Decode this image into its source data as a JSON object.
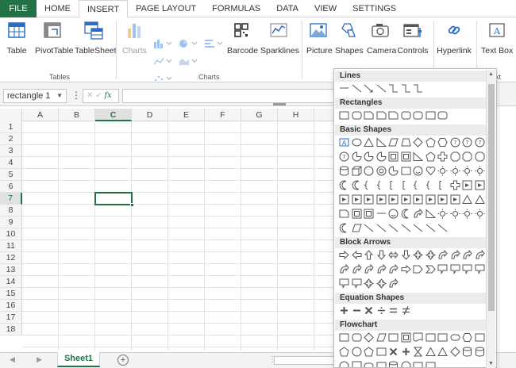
{
  "tabs": [
    {
      "label": "FILE"
    },
    {
      "label": "HOME"
    },
    {
      "label": "INSERT"
    },
    {
      "label": "PAGE LAYOUT"
    },
    {
      "label": "FORMULAS"
    },
    {
      "label": "DATA"
    },
    {
      "label": "VIEW"
    },
    {
      "label": "SETTINGS"
    }
  ],
  "ribbon": {
    "table": "Table",
    "pivottable": "PivotTable",
    "tablesheet": "TableSheet",
    "group_tables": "Tables",
    "charts": "Charts",
    "barcode": "Barcode",
    "sparklines": "Sparklines",
    "group_charts": "Charts",
    "picture": "Picture",
    "shapes": "Shapes",
    "camera": "Camera",
    "controls": "Controls",
    "hyperlink": "Hyperlink",
    "textbox": "Text Box",
    "group_text_partial": "xt"
  },
  "formula_bar": {
    "name_box": "rectangle 1",
    "fx": "fx",
    "formula": ""
  },
  "columns": [
    "A",
    "B",
    "C",
    "D",
    "E",
    "F",
    "G",
    "H"
  ],
  "selected_column": "C",
  "rows": [
    "1",
    "2",
    "3",
    "4",
    "5",
    "6",
    "7",
    "8",
    "9",
    "10",
    "11",
    "12",
    "13",
    "14",
    "15",
    "16",
    "17",
    "18"
  ],
  "selected_row": "7",
  "sheet": {
    "name": "Sheet1",
    "add": "+"
  },
  "shapes_panel": {
    "lines": "Lines",
    "rectangles": "Rectangles",
    "basic_shapes": "Basic Shapes",
    "block_arrows": "Block Arrows",
    "equation_shapes": "Equation Shapes",
    "flowchart": "Flowchart"
  },
  "colors": {
    "accent": "#217346",
    "icon_blue": "#2b6cc4"
  }
}
